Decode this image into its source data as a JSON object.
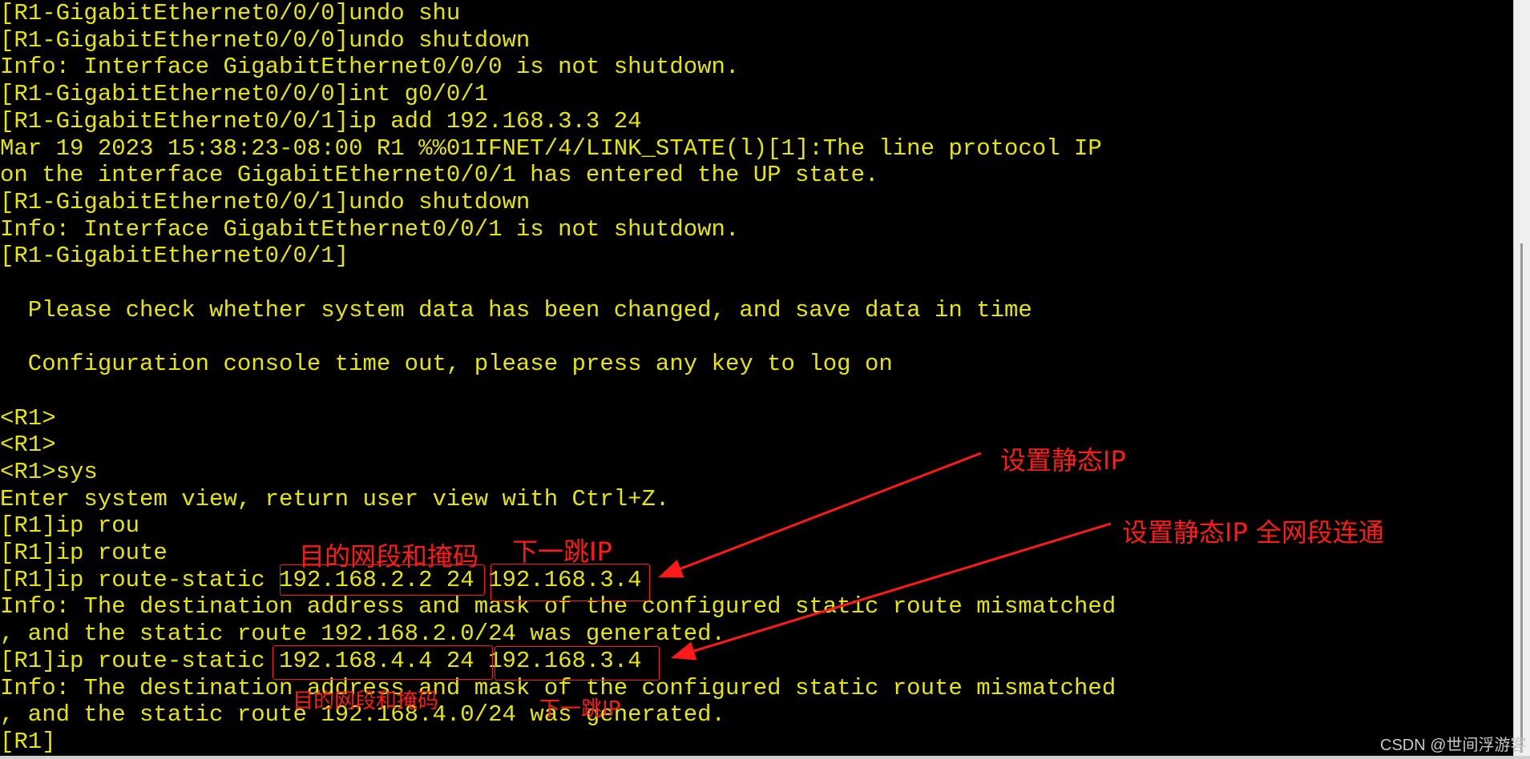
{
  "terminal": {
    "text_color": "#e6e600",
    "background": "#000000",
    "lines": [
      "[R1-GigabitEthernet0/0/0]undo shu",
      "[R1-GigabitEthernet0/0/0]undo shutdown",
      "Info: Interface GigabitEthernet0/0/0 is not shutdown.",
      "[R1-GigabitEthernet0/0/0]int g0/0/1",
      "[R1-GigabitEthernet0/0/1]ip add 192.168.3.3 24",
      "Mar 19 2023 15:38:23-08:00 R1 %%01IFNET/4/LINK_STATE(l)[1]:The line protocol IP",
      "on the interface GigabitEthernet0/0/1 has entered the UP state.",
      "[R1-GigabitEthernet0/0/1]undo shutdown",
      "Info: Interface GigabitEthernet0/0/1 is not shutdown.",
      "[R1-GigabitEthernet0/0/1]",
      "",
      "  Please check whether system data has been changed, and save data in time",
      "",
      "  Configuration console time out, please press any key to log on",
      "",
      "<R1>",
      "<R1>",
      "<R1>sys",
      "Enter system view, return user view with Ctrl+Z.",
      "[R1]ip rou",
      "[R1]ip route",
      "[R1]ip route-static 192.168.2.2 24 192.168.3.4",
      "Info: The destination address and mask of the configured static route mismatched",
      ", and the static route 192.168.2.0/24 was generated.",
      "[R1]ip route-static 192.168.4.4 24 192.168.3.4",
      "Info: The destination address and mask of the configured static route mismatched",
      ", and the static route 192.168.4.0/24 was generated.",
      "[R1]"
    ]
  },
  "annotations": {
    "color": "#ff1a1a",
    "dest_mask_label_1": "目的网段和掩码",
    "next_hop_label_1": "下一跳IP",
    "dest_mask_label_2": "目的网段和掩码",
    "next_hop_label_2": "下一跳IP",
    "callout_1": "设置静态IP",
    "callout_2": "设置静态IP 全网段连通"
  },
  "watermark": "CSDN @世间浮游客"
}
